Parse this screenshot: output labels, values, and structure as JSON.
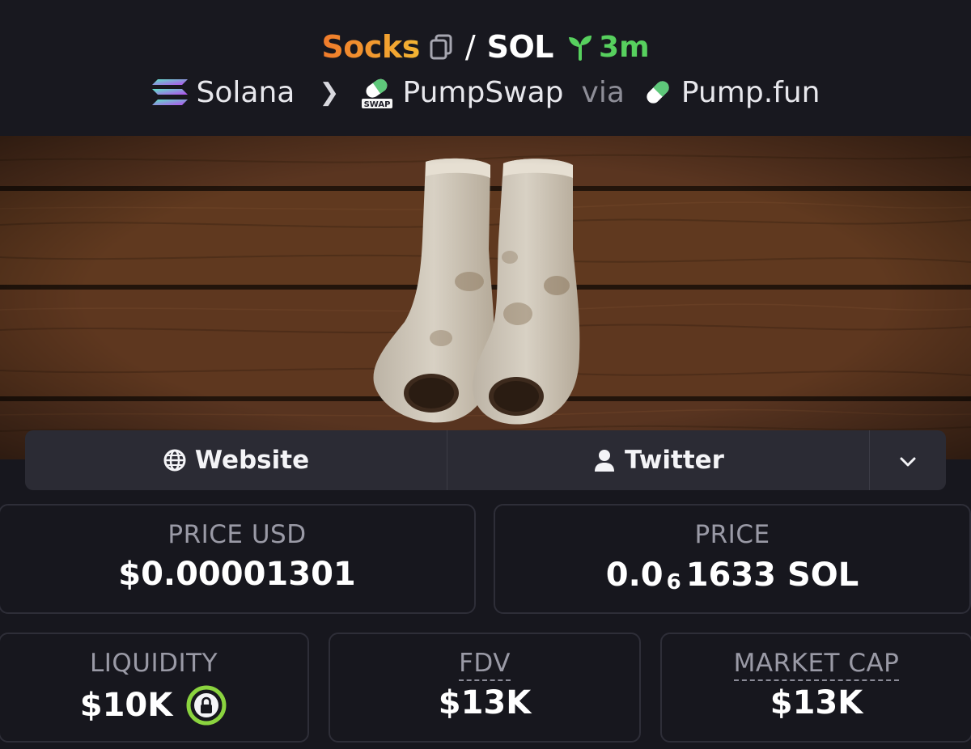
{
  "header": {
    "base_token": "Socks",
    "separator": "/",
    "quote_token": "SOL",
    "age": "3m",
    "chain": "Solana",
    "dex": "PumpSwap",
    "via_label": "via",
    "launchpad": "Pump.fun",
    "dex_badge": "SWAP"
  },
  "links": {
    "website_label": "Website",
    "twitter_label": "Twitter"
  },
  "stats": {
    "price_usd": {
      "label": "PRICE USD",
      "value": "$0.00001301"
    },
    "price": {
      "label": "PRICE",
      "prefix": "0.0",
      "zeros": "6",
      "suffix": "1633 SOL"
    },
    "liquidity": {
      "label": "LIQUIDITY",
      "value": "$10K"
    },
    "fdv": {
      "label": "FDV",
      "value": "$13K"
    },
    "market_cap": {
      "label": "MARKET CAP",
      "value": "$13K"
    }
  },
  "colors": {
    "ticker_gradient_start": "#f07a2b",
    "ticker_gradient_end": "#f3b533",
    "age_green": "#57d05e",
    "lock_ring": "#8bd43f",
    "background": "#17171e",
    "link_bar": "#2b2b34"
  },
  "icons": {
    "copy": "copy-icon",
    "age": "sprout-icon",
    "chain": "solana-logo-icon",
    "dex": "pumpswap-pill-icon",
    "launchpad": "pill-icon",
    "website": "globe-icon",
    "twitter": "user-icon",
    "more": "chevron-down-icon",
    "liquidity": "lock-icon"
  },
  "banner": {
    "image": "two-worn-socks-on-wooden-floor"
  }
}
